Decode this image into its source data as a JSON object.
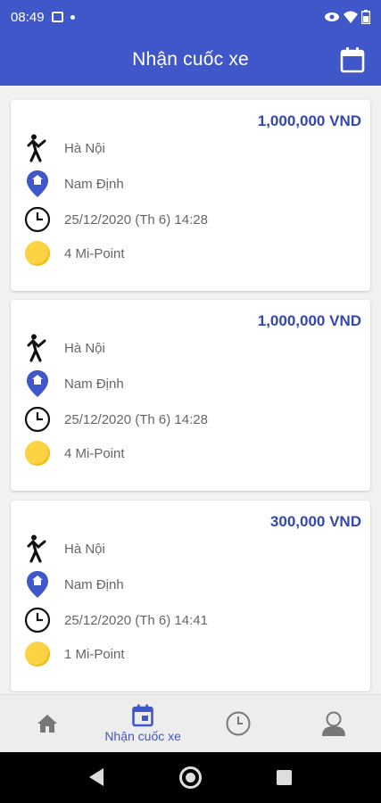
{
  "status_bar": {
    "time": "08:49"
  },
  "header": {
    "title": "Nhận cuốc xe"
  },
  "colors": {
    "primary": "#3f57c8",
    "price": "#3148b0",
    "coin": "#fcd443"
  },
  "rides": [
    {
      "price": "1,000,000 VND",
      "pickup": "Hà Nội",
      "destination": "Nam Định",
      "datetime": "25/12/2020 (Th 6) 14:28",
      "points": "4 Mi-Point"
    },
    {
      "price": "1,000,000 VND",
      "pickup": "Hà Nội",
      "destination": "Nam Định",
      "datetime": "25/12/2020 (Th 6) 14:28",
      "points": "4 Mi-Point"
    },
    {
      "price": "300,000 VND",
      "pickup": "Hà Nội",
      "destination": "Nam Định",
      "datetime": "25/12/2020 (Th 6) 14:41",
      "points": "1 Mi-Point"
    }
  ],
  "bottom_nav": {
    "items": [
      {
        "icon": "home-icon",
        "label": ""
      },
      {
        "icon": "calendar-icon",
        "label": "Nhận cuốc xe",
        "active": true
      },
      {
        "icon": "clock-icon",
        "label": ""
      },
      {
        "icon": "user-icon",
        "label": ""
      }
    ]
  }
}
